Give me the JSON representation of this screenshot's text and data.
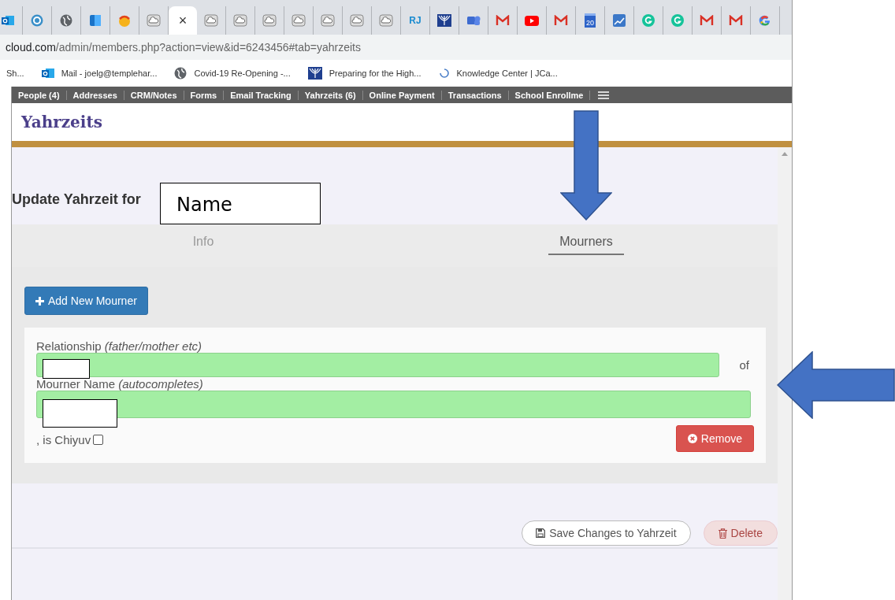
{
  "browser_tabs": [
    {
      "kind": "outlook",
      "selected": false
    },
    {
      "kind": "target",
      "selected": false
    },
    {
      "kind": "globe",
      "selected": false
    },
    {
      "kind": "square",
      "selected": false
    },
    {
      "kind": "smiley",
      "selected": false
    },
    {
      "kind": "cloud",
      "selected": false
    },
    {
      "kind": "close",
      "label": "×",
      "selected": true
    },
    {
      "kind": "cloud",
      "selected": false
    },
    {
      "kind": "cloud",
      "selected": false
    },
    {
      "kind": "cloud",
      "selected": false
    },
    {
      "kind": "cloud",
      "selected": false
    },
    {
      "kind": "cloud",
      "selected": false
    },
    {
      "kind": "cloud",
      "selected": false
    },
    {
      "kind": "cloud",
      "selected": false
    },
    {
      "kind": "text",
      "label": "RJ",
      "selected": false
    },
    {
      "kind": "menorah",
      "selected": false
    },
    {
      "kind": "chat",
      "selected": false
    },
    {
      "kind": "mail",
      "selected": false
    },
    {
      "kind": "play",
      "selected": false
    },
    {
      "kind": "mail",
      "selected": false
    },
    {
      "kind": "calendar",
      "label": "20",
      "selected": false
    },
    {
      "kind": "chart",
      "selected": false
    },
    {
      "kind": "gcircle",
      "selected": false
    },
    {
      "kind": "gcircle",
      "selected": false
    },
    {
      "kind": "mail",
      "selected": false
    },
    {
      "kind": "mail",
      "selected": false
    },
    {
      "kind": "google",
      "selected": false
    }
  ],
  "address_bar": {
    "domain": "cloud.com",
    "path": "/admin/members.php?action=view&id=6243456#tab=yahrzeits"
  },
  "bookmarks": [
    {
      "kind": "plain",
      "label": "Sh..."
    },
    {
      "kind": "outlook",
      "label": "Mail - joelg@templehar..."
    },
    {
      "kind": "globe",
      "label": "Covid-19 Re-Opening -..."
    },
    {
      "kind": "menorah",
      "label": "Preparing for the High..."
    },
    {
      "kind": "spinner",
      "label": "Knowledge Center | JCa..."
    }
  ],
  "nav_tabs": [
    "People (4)",
    "Addresses",
    "CRM/Notes",
    "Forms",
    "Email Tracking",
    "Yahrzeits (6)",
    "Online Payment",
    "Transactions",
    "School Enrollme"
  ],
  "panel_title": "Yahrzeits",
  "heading": "Update Yahrzeit for",
  "form_tabs": [
    {
      "label": "Info",
      "selected": false
    },
    {
      "label": "Mourners",
      "selected": true
    }
  ],
  "add_button": "Add New Mourner",
  "mourner": {
    "relationship_label": "Relationship *(father/mother etc)*",
    "of_label": "of",
    "name_label": "Mourner Name *(autocompletes)*",
    "chiyuv_label": ", is Chiyuv",
    "chiyuv_checked": false,
    "remove_button": "Remove"
  },
  "save_button": "Save Changes to Yahrzeit",
  "delete_button": "Delete",
  "annotations": [
    {
      "kind": "label-box",
      "text": "Name"
    },
    {
      "kind": "down-arrow"
    },
    {
      "kind": "left-arrow"
    },
    {
      "kind": "redaction"
    },
    {
      "kind": "redaction"
    }
  ]
}
